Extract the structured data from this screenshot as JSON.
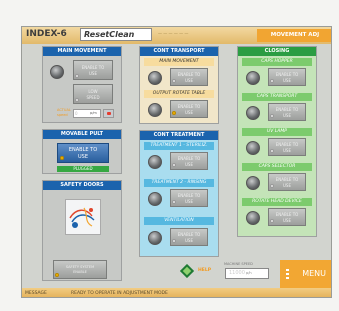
{
  "header": {
    "title": "INDEX-6",
    "brand": "ResetClean",
    "middle": "— — — — — —",
    "right_label": "MOVEMENT ADJ"
  },
  "main_movement": {
    "title": "MAIN MOVEMENT",
    "enable_label": "ENABLE TO USE",
    "low_speed_label": "LOW SPEED",
    "actual_label": "ACTUAL",
    "speed_label": "speed",
    "unit": "p/m",
    "value": "0"
  },
  "movable_pult": {
    "title": "MOVABLE PULT",
    "enable_label": "ENABLE TO USE",
    "status": "PLUGGED"
  },
  "safety_doors": {
    "title": "SAFETY DOORS",
    "system_label": "SAFETY SYSTEM ENABLE"
  },
  "cont_transport": {
    "title": "CONT TRANSPORT",
    "items": [
      {
        "label": "MAIN MOVEMENT",
        "button": "ENABLE TO USE"
      },
      {
        "label": "OUTPUT ROTATE TABLE",
        "button": "ENABLE TO USE"
      }
    ]
  },
  "cont_treatment": {
    "title": "CONT TREATMENT",
    "items": [
      {
        "label": "TREATMENT 1 - STERILIZ.",
        "button": "ENABLE TO USE"
      },
      {
        "label": "TREATMENT 2 - RINSING",
        "button": "ENABLE TO USE"
      },
      {
        "label": "VENTILATION",
        "button": "ENABLE TO USE"
      }
    ]
  },
  "closing": {
    "title": "CLOSING",
    "items": [
      {
        "label": "CAPS HOPPER",
        "button": "ENABLE TO USE"
      },
      {
        "label": "CAPS TRANSPORT",
        "button": "ENABLE TO USE"
      },
      {
        "label": "UV LAMP",
        "button": "ENABLE TO USE"
      },
      {
        "label": "CAPS SELECTOR",
        "button": "ENABLE TO USE"
      },
      {
        "label": "ROTATE HEAD DEVICE",
        "button": "ENABLE TO USE"
      }
    ]
  },
  "help": {
    "label": "HELP"
  },
  "machine_speed": {
    "label": "MACHINE SPEED",
    "value": "11000",
    "unit": "p/h"
  },
  "menu": {
    "label": "MENU"
  },
  "status": {
    "label": "MESSAGE",
    "text": "READY TO OPERATE IN ADJUSTMENT MODE"
  },
  "colors": {
    "blue": "#1b63ad",
    "green": "#2b9d43",
    "orange": "#f2a733"
  }
}
